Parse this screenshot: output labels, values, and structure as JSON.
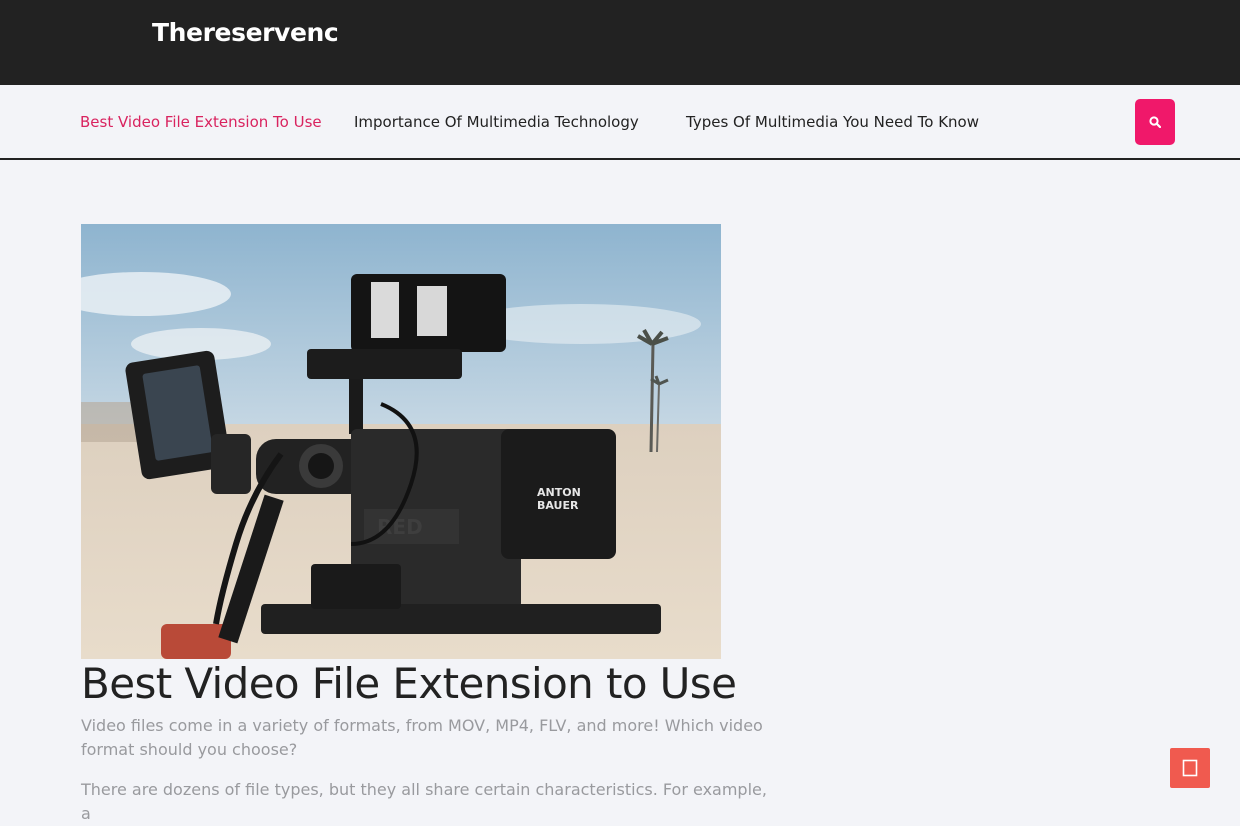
{
  "header": {
    "site_title": "Thereservenc"
  },
  "nav": {
    "items": [
      {
        "label": "Best Video File Extension To Use",
        "active": true
      },
      {
        "label": "Importance Of Multimedia Technology",
        "active": false
      },
      {
        "label": "Types Of Multimedia You Need To Know",
        "active": false
      }
    ],
    "search_icon": "search-icon"
  },
  "article": {
    "title": "Best Video File Extension to Use",
    "paragraphs": [
      "Video files come in a variety of formats, from MOV, MP4, FLV, and more! Which video format should you choose?",
      "There are dozens of file types, but they all share certain characteristics. For example, a"
    ],
    "hero_text": [
      "ANTON",
      "BAUER",
      "RED"
    ]
  },
  "controls": {
    "back_to_top_icon": "arrow-up-icon"
  },
  "colors": {
    "topbar": "#222222",
    "accent": "#f0186a",
    "active_nav": "#d9235f",
    "back_to_top": "#f05a4f",
    "page_bg": "#f3f4f8"
  }
}
